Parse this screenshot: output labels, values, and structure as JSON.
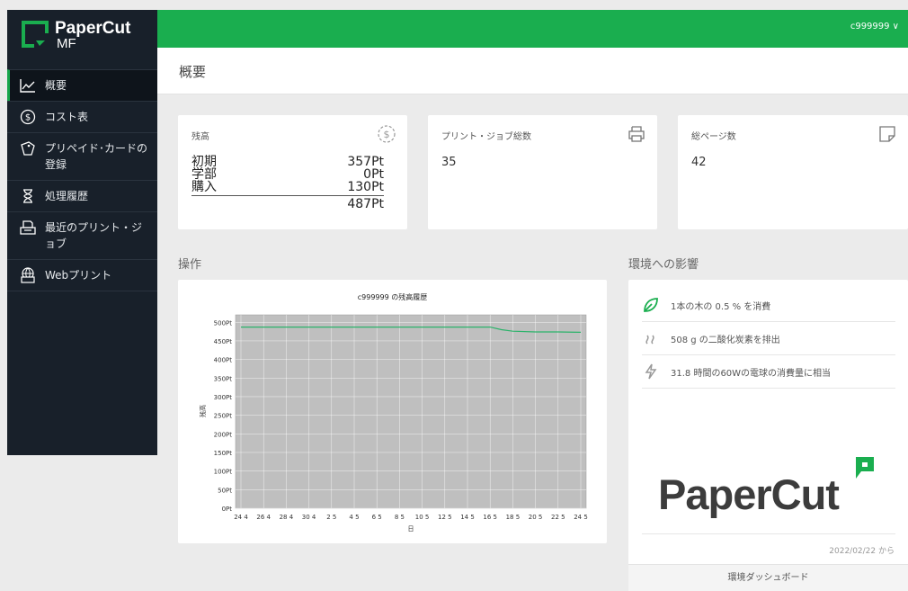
{
  "brand": {
    "name": "PaperCut",
    "sub": "MF",
    "accent": "#1aae4f",
    "sidebar_bg": "#18202a"
  },
  "header": {
    "user": "c999999 ∨"
  },
  "page": {
    "title": "概要"
  },
  "sidebar": {
    "items": [
      {
        "label": "概要",
        "icon": "chart-line-icon",
        "active": true
      },
      {
        "label": "コスト表",
        "icon": "dollar-circle-icon"
      },
      {
        "label": "プリペイド･カードの登録",
        "icon": "tag-icon"
      },
      {
        "label": "処理履歴",
        "icon": "hourglass-icon"
      },
      {
        "label": "最近のプリント・ジョブ",
        "icon": "printer-tray-icon"
      },
      {
        "label": "Webプリント",
        "icon": "globe-printer-icon"
      }
    ]
  },
  "balance": {
    "title": "残高",
    "rows": [
      {
        "label": "初期",
        "value": "357Pt"
      },
      {
        "label": "学部",
        "value": "0Pt"
      },
      {
        "label": "購入",
        "value": "130Pt"
      }
    ],
    "total": "487Pt"
  },
  "jobs": {
    "title": "プリント・ジョブ総数",
    "value": "35"
  },
  "pages": {
    "title": "総ページ数",
    "value": "42"
  },
  "sections": {
    "activity": "操作",
    "environment": "環境への影響"
  },
  "chart_data": {
    "type": "line",
    "title": "c999999 の残高履歴",
    "xlabel": "日",
    "ylabel": "残高",
    "x": [
      "24 4",
      "26 4",
      "28 4",
      "30 4",
      "2 5",
      "4 5",
      "6 5",
      "8 5",
      "10 5",
      "12 5",
      "14 5",
      "16 5",
      "18 5",
      "20 5",
      "22 5",
      "24 5"
    ],
    "y_ticks": [
      "0Pt",
      "50Pt",
      "100Pt",
      "150Pt",
      "200Pt",
      "250Pt",
      "300Pt",
      "350Pt",
      "400Pt",
      "450Pt",
      "500Pt"
    ],
    "ylim": [
      0,
      520
    ],
    "series": [
      {
        "x": [
          0,
          1,
          2,
          3,
          4,
          5,
          6,
          7,
          8,
          9,
          10,
          11,
          11.5,
          12,
          13,
          14,
          15
        ],
        "values": [
          487,
          487,
          487,
          487,
          487,
          487,
          487,
          487,
          487,
          487,
          487,
          487,
          480,
          476,
          474,
          474,
          473
        ]
      }
    ],
    "plot_bg": "#bfbfbf",
    "line_color": "#2bb36a",
    "grid": true
  },
  "environment": {
    "items": [
      {
        "icon": "leaf-icon",
        "text": "1本の木の 0.5 % を消費"
      },
      {
        "icon": "smoke-icon",
        "text": "508 g の二酸化炭素を排出"
      },
      {
        "icon": "lightning-icon",
        "text": "31.8 時間の60Wの電球の消費量に相当"
      }
    ],
    "logo": "PaperCut",
    "since": "2022/02/22 から",
    "dashboard_link": "環境ダッシュボード"
  }
}
